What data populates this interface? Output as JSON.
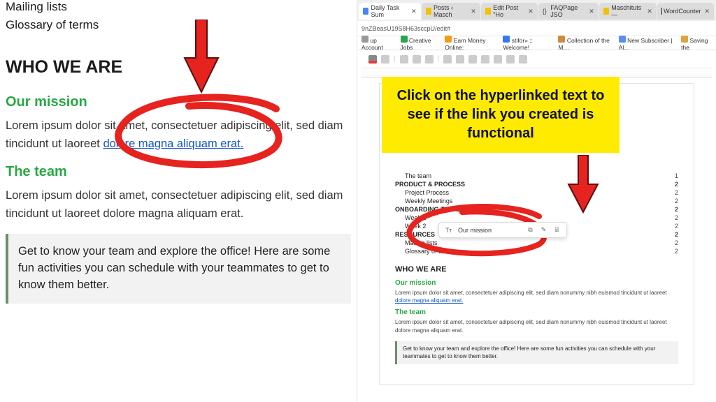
{
  "left": {
    "nav": [
      "Mailing lists",
      "Glossary of terms"
    ],
    "heading": "WHO WE ARE",
    "mission_h": "Our mission",
    "mission_p_a": "Lorem ipsum dolor sit amet, consectetuer adipiscing elit, sed diam tincidunt ut laoreet",
    "mission_link": " dolore magna aliquam erat.",
    "team_h": "The team",
    "team_p": "Lorem ipsum dolor sit amet, consectetuer adipiscing elit, sed diam tincidunt ut laoreet dolore magna aliquam erat.",
    "callout": "Get to know your team and explore the office! Here are some fun activities you can schedule with your teammates to get to know them better."
  },
  "annotation": {
    "text": "Click on the hyperlinked text to see if the link you created is functional"
  },
  "browser": {
    "tabs": [
      {
        "label": "Daily Task Sum"
      },
      {
        "label": "Posts ‹ Masch"
      },
      {
        "label": "Edit Post \"Ho"
      },
      {
        "label": "FAQPage JSO"
      },
      {
        "label": "Maschituts —"
      },
      {
        "label": "WordCounter"
      }
    ],
    "url": "9nZBeasU19S8H63sccpU/edit#",
    "bookmarks": [
      "up Account",
      "Creative Jobs",
      "Earn Money Online:",
      "stifor» :: Welcome!",
      "Collection of the M…",
      "New Subscriber | Al…",
      "Saving the"
    ]
  },
  "doc": {
    "toc": [
      {
        "l": "The team",
        "r": "1",
        "indent": true
      },
      {
        "l": "PRODUCT & PROCESS",
        "r": "2",
        "bold": true
      },
      {
        "l": "Project Process",
        "r": "2",
        "indent": true
      },
      {
        "l": "Weekly Meetings",
        "r": "2",
        "indent": true
      },
      {
        "l": "ONBOARDING TASKLIST",
        "r": "2",
        "bold": true
      },
      {
        "l": "Week 1",
        "r": "2",
        "indent": true
      },
      {
        "l": "Week 2",
        "r": "2",
        "indent": true
      },
      {
        "l": "RESOURCES",
        "r": "2",
        "bold": true
      },
      {
        "l": "Mailing lists",
        "r": "2",
        "indent": true
      },
      {
        "l": "Glossary of terms",
        "r": "2",
        "indent": true
      }
    ],
    "h1": "WHO WE ARE",
    "mission_h": "Our mission",
    "mission_p_a": "Lorem ipsum dolor sit amet, consectetuer adipiscing elit, sed diam nonummy nibh euismod tincidunt ut laoreet",
    "mission_link": "dolore magna aliquam erat.",
    "team_h": "The team",
    "team_p": "Lorem ipsum dolor sit amet, consectetuer adipiscing elit, sed diam nonummy nibh euismod tincidunt ut laoreet dolore magna aliquam erat.",
    "callout": "Get to know your team and explore the office! Here are some fun activities you can schedule with your teammates to get to know them better.",
    "popover_label": "Our mission"
  },
  "icons": {
    "copy": "⧉",
    "edit": "✎",
    "unlink": "⍯",
    "tt": "Tт"
  }
}
